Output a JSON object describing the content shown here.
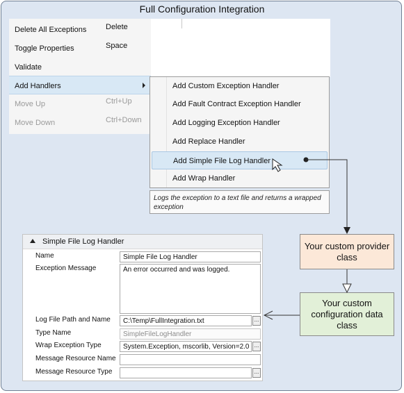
{
  "title": "Full Configuration Integration",
  "context_menu": {
    "items": [
      {
        "label": "Delete All Exceptions",
        "shortcut": "Delete",
        "state": "normal"
      },
      {
        "label": "Toggle Properties",
        "shortcut": "Space",
        "state": "normal"
      },
      {
        "label": "Validate",
        "shortcut": "",
        "state": "normal"
      },
      {
        "label": "Add Handlers",
        "shortcut": "",
        "state": "highlighted"
      },
      {
        "label": "Move Up",
        "shortcut": "Ctrl+Up",
        "state": "disabled"
      },
      {
        "label": "Move Down",
        "shortcut": "Ctrl+Down",
        "state": "disabled"
      }
    ]
  },
  "submenu": {
    "items": [
      {
        "label": "Add Custom Exception Handler",
        "highlighted": false
      },
      {
        "label": "Add Fault Contract Exception Handler",
        "highlighted": false
      },
      {
        "label": "Add Logging Exception Handler",
        "highlighted": false
      },
      {
        "label": "Add Replace Handler",
        "highlighted": false
      },
      {
        "label": "Add Simple File Log Handler",
        "highlighted": true
      },
      {
        "label": "Add Wrap Handler",
        "highlighted": false
      }
    ],
    "tooltip": "Logs the exception to a text file and returns a wrapped exception"
  },
  "properties_panel": {
    "header": "Simple File Log Handler",
    "rows": [
      {
        "label": "Name",
        "value": "Simple File Log Handler",
        "readonly": false,
        "has_button": false
      },
      {
        "label": "Exception Message",
        "value": "An error occurred and was logged.",
        "readonly": false,
        "has_button": false
      },
      {
        "label": "Log File Path and Name",
        "value": "C:\\Temp\\FullIntegration.txt",
        "readonly": false,
        "has_button": true
      },
      {
        "label": "Type Name",
        "value": "SimpleFileLogHandler",
        "readonly": true,
        "has_button": false
      },
      {
        "label": "Wrap Exception Type",
        "value": "System.Exception, mscorlib, Version=2.0",
        "readonly": false,
        "has_button": true
      },
      {
        "label": "Message Resource Name",
        "value": "",
        "readonly": false,
        "has_button": false
      },
      {
        "label": "Message Resource Type",
        "value": "",
        "readonly": false,
        "has_button": true
      }
    ],
    "button_label": "..."
  },
  "boxes": {
    "provider": "Your custom provider class",
    "config": "Your custom configuration data class"
  },
  "colors": {
    "background": "#dde6f2",
    "provider_fill": "#fce8d8",
    "config_fill": "#e2f0d8",
    "highlight": "#d8e8f5"
  }
}
